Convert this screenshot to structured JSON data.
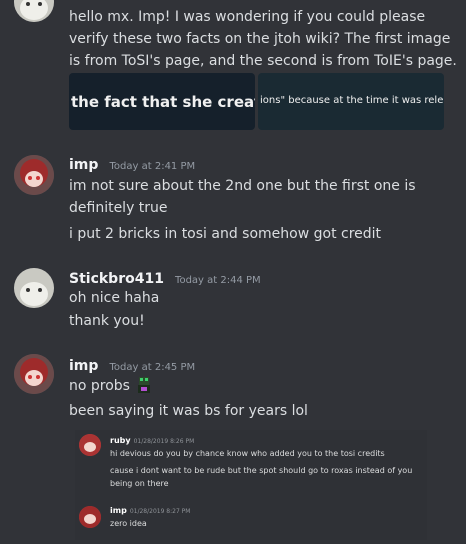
{
  "messages": [
    {
      "avatar_icon": "cat-avatar-icon",
      "lines": [
        "hello mx. Imp! I was wondering if you could please",
        "verify these two facts on the jtoh wiki? The first image",
        "is from ToSI's page, and the second is from ToIE's page."
      ],
      "attachments": [
        "the fact that she create",
        "ions\" because at the time it was relea"
      ]
    },
    {
      "avatar_icon": "imp-avatar-icon",
      "username": "imp",
      "timestamp": "Today at 2:41 PM",
      "lines": [
        "im not sure about the 2nd one but the first one is",
        "definitely true"
      ],
      "extra_line": "i put 2 bricks in tosi and somehow got credit"
    },
    {
      "avatar_icon": "cat-avatar-icon",
      "username": "Stickbro411",
      "timestamp": "Today at 2:44 PM",
      "lines": [
        "oh nice haha",
        "thank you!"
      ]
    },
    {
      "avatar_icon": "imp-avatar-icon",
      "username": "imp",
      "timestamp": "Today at 2:45 PM",
      "lines": [
        "no probs"
      ],
      "emoji": "sprite-emoji-icon",
      "extra_line": "been saying it was bs for years lol",
      "embedded_screenshot": {
        "entries": [
          {
            "username": "ruby",
            "timestamp": "01/28/2019 8:26 PM",
            "lines": [
              "hi devious do you by chance know who added you to the tosi credits",
              "cause i dont want to be rude but the spot should go to roxas instead of you",
              "being on there"
            ]
          },
          {
            "username": "imp",
            "timestamp": "01/28/2019 8:27 PM",
            "lines": [
              "zero idea"
            ]
          }
        ]
      }
    }
  ],
  "colors": {
    "background": "#313338",
    "username": "#f2f3f5",
    "timestamp": "#949ba4",
    "text": "#dbdee1"
  }
}
